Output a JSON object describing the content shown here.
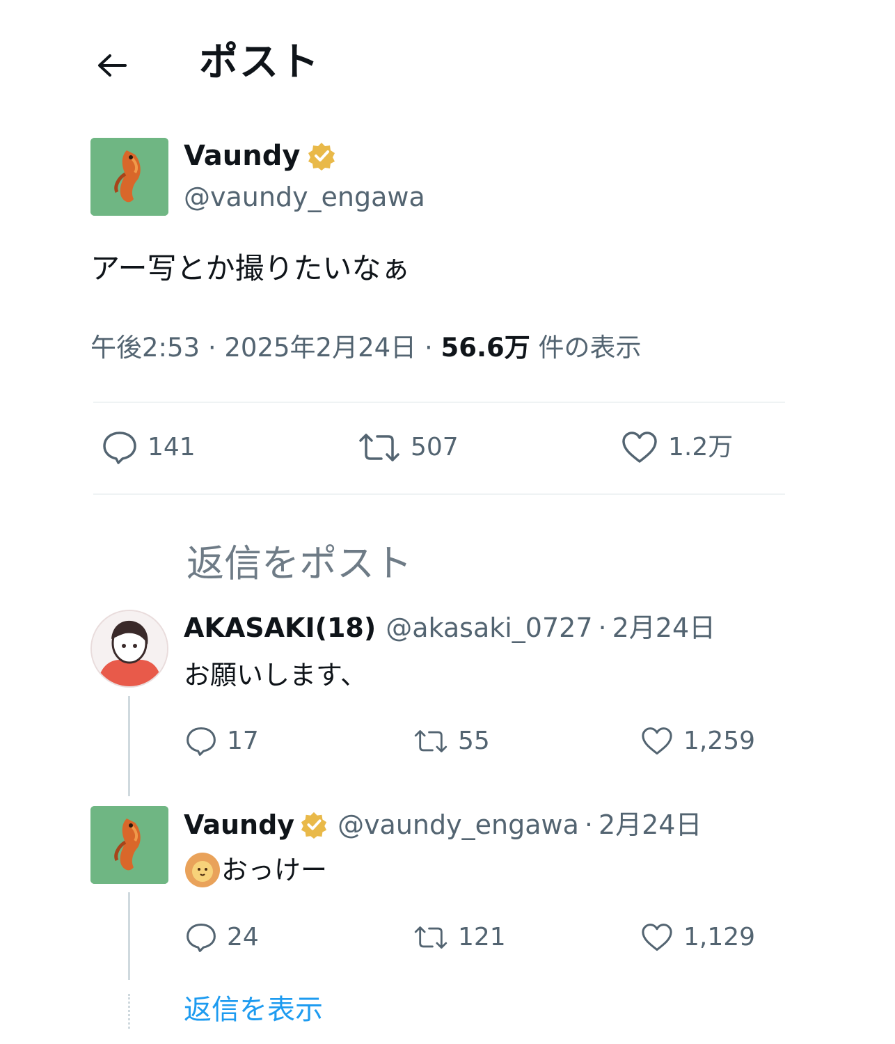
{
  "header": {
    "title": "ポスト"
  },
  "post": {
    "author": {
      "name": "Vaundy",
      "handle": "@vaundy_engawa"
    },
    "text": "アー写とか撮りたいなぁ",
    "time": "午後2:53",
    "date": "2025年2月24日",
    "views": "56.6万",
    "views_label": "件の表示",
    "stats": {
      "replies": "141",
      "reposts": "507",
      "likes": "1.2万"
    }
  },
  "reply_prompt": "返信をポスト",
  "replies": [
    {
      "name": "AKASAKI(18)",
      "handle": "@akasaki_0727",
      "date": "2月24日",
      "text": "お願いします、",
      "stats": {
        "replies": "17",
        "reposts": "55",
        "likes": "1,259"
      }
    },
    {
      "name": "Vaundy",
      "handle": "@vaundy_engawa",
      "date": "2月24日",
      "text": "おっけー",
      "stats": {
        "replies": "24",
        "reposts": "121",
        "likes": "1,129"
      }
    }
  ],
  "show_replies_label": "返信を表示",
  "colors": {
    "accent": "#1d9bf0",
    "verified": "#e9b949",
    "secondary_text": "#536471",
    "avatar_bg": "#6fb683"
  }
}
